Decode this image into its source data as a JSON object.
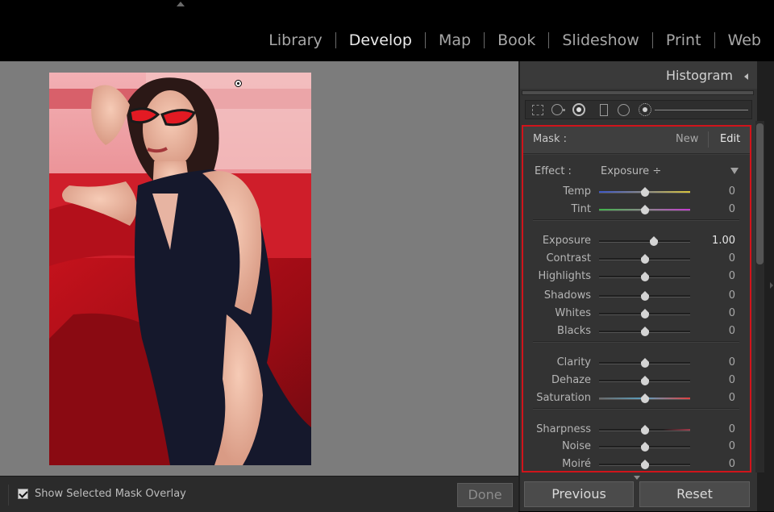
{
  "modules": {
    "items": [
      "Library",
      "Develop",
      "Map",
      "Book",
      "Slideshow",
      "Print",
      "Web"
    ],
    "active": "Develop"
  },
  "histogram": {
    "title": "Histogram"
  },
  "tools": {
    "icons": [
      "crop-overlay-icon",
      "spot-removal-icon",
      "red-eye-icon",
      "graduated-filter-icon",
      "radial-filter-icon",
      "adjustment-brush-icon"
    ],
    "active": "red-eye-icon"
  },
  "mask": {
    "label": "Mask :",
    "new_label": "New",
    "edit_label": "Edit",
    "effect_label": "Effect :",
    "effect_value": "Exposure ÷",
    "groups": [
      {
        "sliders": [
          {
            "label": "Temp",
            "value": "0",
            "level": 0.5,
            "track": "temp"
          },
          {
            "label": "Tint",
            "value": "0",
            "level": 0.5,
            "track": "tint"
          }
        ]
      },
      {
        "sliders": [
          {
            "label": "Exposure",
            "value": "1.00",
            "level": 0.6,
            "track": "plain",
            "highlight": true
          },
          {
            "label": "Contrast",
            "value": "0",
            "level": 0.5,
            "track": "plain"
          },
          {
            "label": "Highlights",
            "value": "0",
            "level": 0.5,
            "track": "plain"
          },
          {
            "label": "Shadows",
            "value": "0",
            "level": 0.5,
            "track": "plain"
          },
          {
            "label": "Whites",
            "value": "0",
            "level": 0.5,
            "track": "plain"
          },
          {
            "label": "Blacks",
            "value": "0",
            "level": 0.5,
            "track": "plain"
          }
        ]
      },
      {
        "sliders": [
          {
            "label": "Clarity",
            "value": "0",
            "level": 0.5,
            "track": "plain"
          },
          {
            "label": "Dehaze",
            "value": "0",
            "level": 0.5,
            "track": "plain"
          },
          {
            "label": "Saturation",
            "value": "0",
            "level": 0.5,
            "track": "saturation"
          }
        ]
      },
      {
        "sliders": [
          {
            "label": "Sharpness",
            "value": "0",
            "level": 0.5,
            "track": "sharpness"
          },
          {
            "label": "Noise",
            "value": "0",
            "level": 0.5,
            "track": "plain"
          },
          {
            "label": "Moiré",
            "value": "0",
            "level": 0.5,
            "track": "plain"
          }
        ]
      }
    ]
  },
  "toolbar": {
    "overlay_label": "Show Selected Mask Overlay",
    "overlay_checked": true,
    "done_label": "Done"
  },
  "buttons": {
    "previous_label": "Previous",
    "reset_label": "Reset"
  },
  "colors": {
    "mask_border": "#d0141b"
  }
}
